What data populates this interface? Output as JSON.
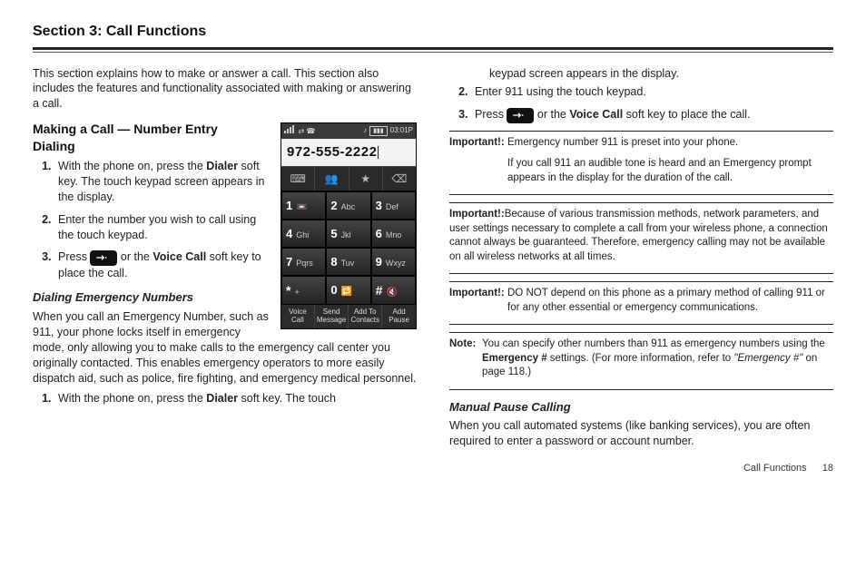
{
  "title": "Section 3: Call Functions",
  "intro": "This section explains how to make or answer a call. This section also includes the features and functionality associated with making or answering a call.",
  "making": {
    "heading": "Making a Call — Number Entry Dialing",
    "steps": {
      "s1a": "With the phone on, press the ",
      "s1b": "Dialer",
      "s1c": " soft key. The touch keypad screen appears in the display.",
      "s2": "Enter the number you wish to call using the touch keypad.",
      "s3a": "Press ",
      "s3b": " or the ",
      "s3c": "Voice Call",
      "s3d": " soft key to place the call."
    }
  },
  "emerg": {
    "heading": "Dialing Emergency Numbers",
    "p1": "When you call an Emergency Number, such as 911, your phone locks itself in emergency mode, only allowing you to make calls to the emergency call center you originally contacted. This enables emergency operators to more easily dispatch aid, such as police, fire fighting, and emergency medical personnel.",
    "s1a": "With the phone on, press the ",
    "s1b": "Dialer",
    "s1c": " soft key. The touch"
  },
  "phone": {
    "time": "03:01P",
    "number": "972-555-2222",
    "keys": [
      {
        "n": "1",
        "l": ""
      },
      {
        "n": "2",
        "l": "Abc"
      },
      {
        "n": "3",
        "l": "Def"
      },
      {
        "n": "4",
        "l": "Ghi"
      },
      {
        "n": "5",
        "l": "Jkl"
      },
      {
        "n": "6",
        "l": "Mno"
      },
      {
        "n": "7",
        "l": "Pqrs"
      },
      {
        "n": "8",
        "l": "Tuv"
      },
      {
        "n": "9",
        "l": "Wxyz"
      },
      {
        "n": "*",
        "l": "+"
      },
      {
        "n": "0",
        "l": ""
      },
      {
        "n": "#",
        "l": ""
      }
    ],
    "soft": [
      "Voice Call",
      "Send Message",
      "Add To Contacts",
      "Add Pause"
    ]
  },
  "col2": {
    "cont": "keypad screen appears in the display.",
    "s2": "Enter 911 using the touch keypad.",
    "s3a": "Press ",
    "s3b": " or the ",
    "s3c": "Voice Call",
    "s3d": " soft key to place the call.",
    "imp1": {
      "label": "Important!:",
      "body": "Emergency number 911 is preset into your phone.",
      "body2": "If you call 911 an audible tone is heard and an Emergency prompt appears in the display for the duration of the call."
    },
    "imp2": {
      "label": "Important!:",
      "body": "Because of various transmission methods, network parameters, and user settings necessary to complete a call from your wireless phone, a connection cannot always be guaranteed. Therefore, emergency calling may not be available on all wireless networks at all times."
    },
    "imp3": {
      "label": "Important!:",
      "body": "DO NOT depend on this phone as a primary method of calling 911 or for any other essential or emergency communications."
    },
    "note": {
      "label": "Note:",
      "body_a": "You can specify other numbers than 911 as emergency numbers using the ",
      "body_b": "Emergency #",
      "body_c": " settings. (For more information, refer to ",
      "body_d": "\"Emergency #\"",
      "body_e": " on page 118.)"
    },
    "pause": {
      "heading": "Manual Pause Calling",
      "body": "When you call automated systems (like banking services), you are often required to enter a password or account number."
    }
  },
  "footer": {
    "label": "Call Functions",
    "page": "18"
  }
}
